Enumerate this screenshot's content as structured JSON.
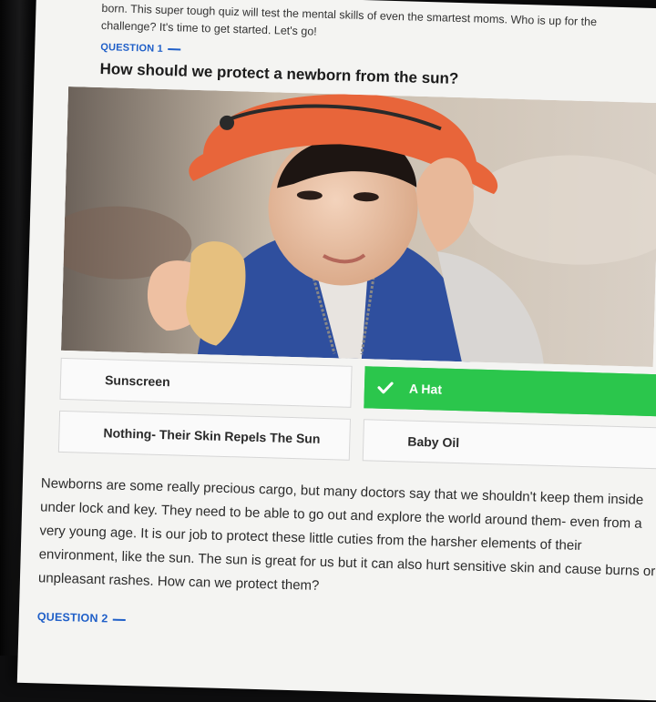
{
  "intro": {
    "line1": "born. This super tough quiz will test the mental skills of even the smartest moms. Who is up for the",
    "line2": "challenge? It's time to get started. Let's go!"
  },
  "question1": {
    "label": "QUESTION 1",
    "title": "How should we protect a newborn from the sun?",
    "answers": [
      {
        "label": "Sunscreen",
        "correct": false
      },
      {
        "label": "A Hat",
        "correct": true
      },
      {
        "label": "Nothing- Their Skin Repels The Sun",
        "correct": false
      },
      {
        "label": "Baby Oil",
        "correct": false
      }
    ],
    "explanation": "Newborns are some really precious cargo, but many doctors say that we shouldn't keep them inside under lock and key. They need to be able to go out and explore the world around them- even from a very young age. It is our job to protect these little cuties from the harsher elements of their environment, like the sun. The sun is great for us but it can also hurt sensitive skin and cause burns or unpleasant rashes. How can we protect them?"
  },
  "question2": {
    "label": "QUESTION 2"
  },
  "colors": {
    "accent_blue": "#1f5fc8",
    "correct_green": "#2bc64c",
    "hat_orange": "#e8653a",
    "vest_blue": "#2f4f9e"
  }
}
